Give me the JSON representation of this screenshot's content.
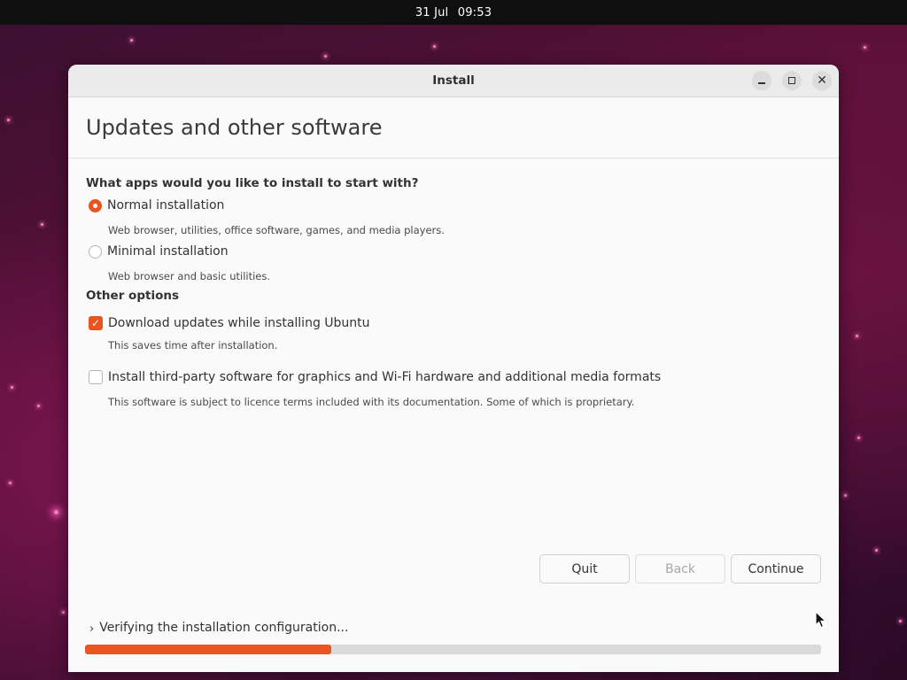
{
  "topbar": {
    "date": "31 Jul",
    "time": "09:53"
  },
  "window": {
    "title": "Install",
    "page_title": "Updates and other software",
    "apps_question": "What apps would you like to install to start with?",
    "options": [
      {
        "label": "Normal installation",
        "description": "Web browser, utilities, office software, games, and media players.",
        "selected": true
      },
      {
        "label": "Minimal installation",
        "description": "Web browser and basic utilities.",
        "selected": false
      }
    ],
    "other_options_heading": "Other options",
    "checkboxes": [
      {
        "label": "Download updates while installing Ubuntu",
        "description": "This saves time after installation.",
        "checked": true
      },
      {
        "label": "Install third-party software for graphics and Wi-Fi hardware and additional media formats",
        "description": "This software is subject to licence terms included with its documentation. Some of which is proprietary.",
        "checked": false
      }
    ],
    "buttons": {
      "quit": "Quit",
      "back": "Back",
      "continue": "Continue"
    },
    "status_text": "Verifying the installation configuration...",
    "progress_fraction": 0.335
  },
  "colors": {
    "accent": "#e95420",
    "topbar": "#0f0f0f",
    "window_bg": "#fafafa"
  },
  "icons": {
    "minimize": "minimize-icon",
    "maximize": "maximize-icon",
    "close": "close-icon",
    "expander": "chevron-right-icon",
    "radio": "radio-icon",
    "checkbox": "checkbox-icon",
    "cursor": "mouse-pointer-icon"
  }
}
